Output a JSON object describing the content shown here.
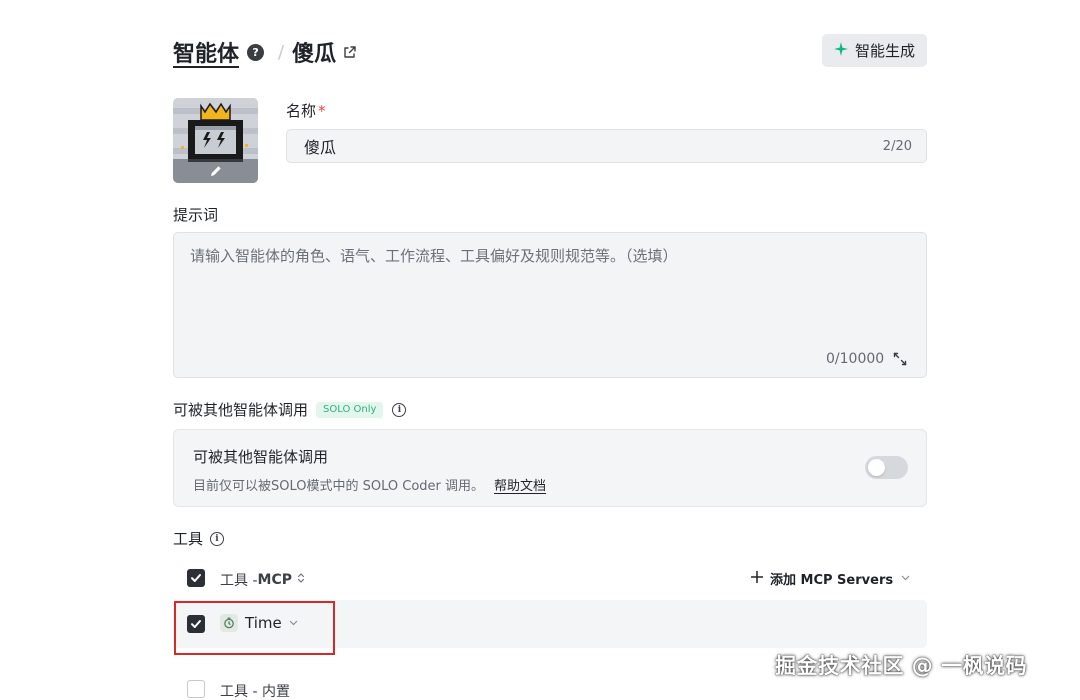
{
  "header": {
    "root_title": "智能体",
    "separator": "/",
    "agent_name": "傻瓜",
    "generate_button": "智能生成",
    "help_icon_glyph": "?"
  },
  "icons": {
    "help": "question-circle-icon",
    "share": "share-icon",
    "sparkle": "sparkle-icon",
    "edit": "pencil-icon",
    "expand": "expand-icon",
    "info": "info-circle-icon",
    "check": "check-icon",
    "plus": "plus-icon",
    "chevron": "chevron-down-icon",
    "sort": "sort-icon",
    "time": "clock-icon"
  },
  "name_field": {
    "label": "名称",
    "required_mark": "*",
    "value": "傻瓜",
    "count": "2/20"
  },
  "prompt_field": {
    "label": "提示词",
    "placeholder": "请输入智能体的角色、语气、工作流程、工具偏好及规则规范等。（选填）",
    "count": "0/10000"
  },
  "callable": {
    "section_title": "可被其他智能体调用",
    "badge": "SOLO Only",
    "card_title": "可被其他智能体调用",
    "card_desc": "目前仅可以被SOLO模式中的 SOLO Coder 调用。",
    "help_link": "帮助文档",
    "enabled": false
  },
  "tools": {
    "section_title": "工具",
    "mcp_group": {
      "prefix": "工具 - ",
      "name": "MCP",
      "checked": true
    },
    "add_mcp_label": "添加 MCP Servers",
    "items": [
      {
        "name": "Time",
        "checked": true
      }
    ],
    "builtin_group": {
      "label": "工具 - 内置",
      "checked": false
    }
  },
  "watermark": "掘金技术社区 @ 一枫说码",
  "colors": {
    "accent_green": "#10b783",
    "required_red": "#e8414a",
    "highlight_red": "#d42a2a",
    "checkbox_dark": "#2b2f36"
  }
}
